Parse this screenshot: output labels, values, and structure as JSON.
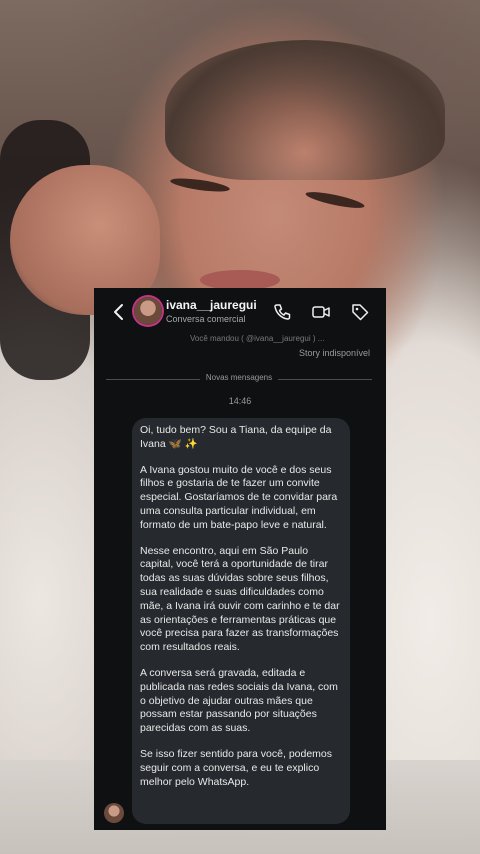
{
  "header": {
    "username": "ivana__jauregui",
    "subtitle": "Conversa comercial",
    "icons": [
      "back-arrow-icon",
      "phone-icon",
      "video-icon",
      "tag-icon"
    ]
  },
  "thread": {
    "cut_text": "Você mandou  ( @ivana__jauregui ) ...",
    "story_status": "Story indisponível",
    "divider_label": "Novas mensagens",
    "timestamp": "14:46",
    "message_paragraphs": [
      "Oi, tudo bem? Sou a Tiana, da equipe da Ivana 🦋 ✨",
      "A Ivana gostou muito de você e dos seus filhos e gostaria de te fazer um convite especial. Gostaríamos de te convidar para uma consulta particular individual, em formato de um bate-papo leve e natural.",
      "Nesse encontro, aqui em São Paulo capital, você terá a oportunidade de tirar todas as suas dúvidas sobre seus filhos, sua realidade e suas dificuldades como mãe, a Ivana irá ouvir com carinho e te dar as orientações e ferramentas práticas que você precisa para fazer as transformações com resultados reais.",
      "A conversa será gravada, editada e publicada nas redes sociais da Ivana, com o objetivo de ajudar outras mães que possam estar passando por situações parecidas com as suas.",
      "Se isso fizer sentido para você, podemos seguir com a conversa, e eu te explico melhor pelo WhatsApp."
    ]
  },
  "colors": {
    "panel_bg": "#0e1012",
    "bubble_bg": "#26292e",
    "text": "#e9e9e9",
    "muted": "#9a9a9a",
    "avatar_ring": "#c13584"
  }
}
